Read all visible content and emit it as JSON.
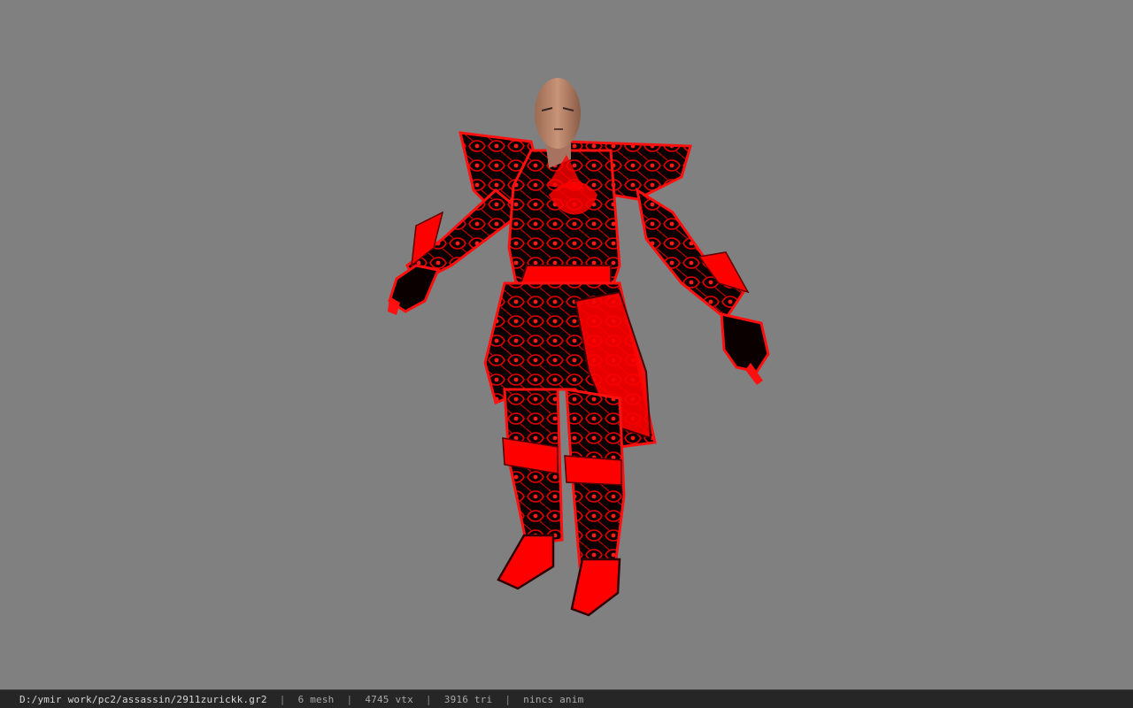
{
  "viewport": {
    "background_color": "#808080",
    "model": {
      "icon": "armored-character-model",
      "armor_color": "#ff0000",
      "armor_dark_color": "#0a0000",
      "skin_color": "#c08a6c"
    }
  },
  "statusbar": {
    "background_color": "#262626",
    "file_path": "D:/ymir work/pc2/assassin/2911zurickk.gr2",
    "separator": "|",
    "mesh": "6 mesh",
    "vertices": "4745 vtx",
    "triangles": "3916 tri",
    "animation": "nincs anim"
  }
}
